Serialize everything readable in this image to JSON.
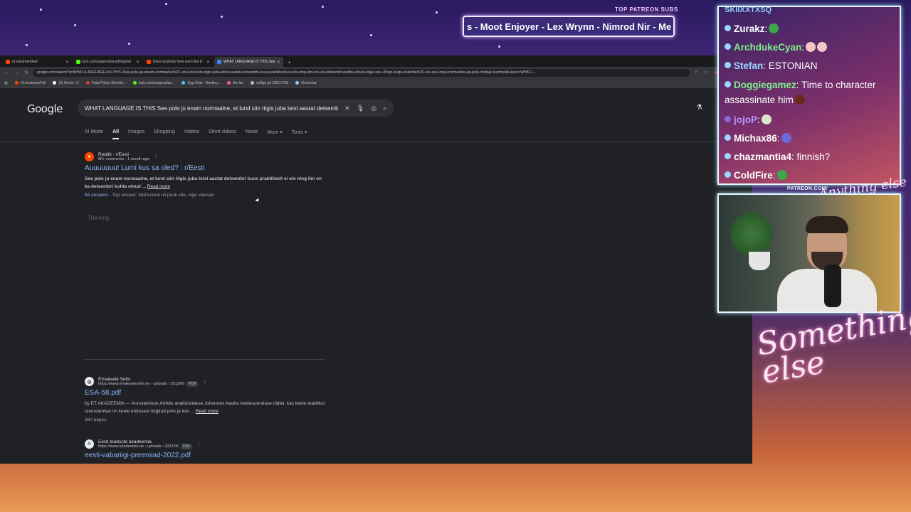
{
  "overlay": {
    "subs_heading": "TOP PATREON SUBS",
    "subs_ticker": "s - Moot Enjoyer - Lex Wrynn - Nimrod Nir - Me",
    "patreon_url": "PATREON.COM/",
    "brand_small": "Anything else",
    "brand_large": "Something else"
  },
  "browser": {
    "tabs": [
      {
        "label": "r/LivestreamFail",
        "color": "#ff4500",
        "active": false
      },
      {
        "label": "kick.com/popeout/anythingelse",
        "color": "#53fc18",
        "active": false
      },
      {
        "label": "Does anybody here even like D",
        "color": "#ff4500",
        "active": false
      },
      {
        "label": "WHAT LANGUAGE IS THIS See",
        "color": "#4285f4",
        "active": true
      }
    ],
    "url": "google.com/search?q=WHAT+LANGUAGE+IS+THIS+See+pole+ju+enam+normaalne%2C+et+lund+siin+riigis+juba+teist+aastat+detsembri+kuus+praktiliselt+ei+ole+ning+ilm+on+ka+detsembri+kohta+olnud+siiga+soe.+Änge+tulge+räakima%2C+et+see+ongi+normaalne+ja+pole+midagi+kummalist.&sca=WHAT+...",
    "bookmarks": [
      {
        "label": "r/LivestreamFail",
        "color": "#ff4500"
      },
      {
        "label": "(5) Home / X",
        "color": "#ffffff"
      },
      {
        "label": "Fatal Police Shootin...",
        "color": "#e53935"
      },
      {
        "label": "kick.com/popeout/an...",
        "color": "#53fc18"
      },
      {
        "label": "Dgg Chat - Destiny...",
        "color": "#4fc3f7"
      },
      {
        "label": "the list",
        "color": "#f06292"
      },
      {
        "label": "exflige.gif (299×278)",
        "color": "#bbbbbb"
      },
      {
        "label": "Omnichat",
        "color": "#90caf9"
      }
    ]
  },
  "google": {
    "logo": "Google",
    "query": "WHAT LANGUAGE IS THIS See pole ju enam normaalne, et lund siin riigis juba teist aastat detsembri",
    "tabs": [
      "AI Mode",
      "All",
      "Images",
      "Shopping",
      "Videos",
      "Short videos",
      "News",
      "More ▾",
      "Tools ▾"
    ],
    "active_tab": "All",
    "thinking": "Thinking",
    "results": [
      {
        "site": "Reddit · r/Eesti",
        "meta": "80+ comments · 1 month ago",
        "title": "Auuuuuuu! Lumi kus sa oled? : r/Eesti",
        "snippet": "See pole ju enam normaalne, et lund siin riigis juba teist aastat detsembri kuus praktiliselt ei ole ning ilm on ka detsembri kohta olnud ...",
        "read_more": "Read more",
        "answers": "84 answers",
        "top_answer": " · Top answer: Mul koeral oli puuk eile, olge valvsad"
      },
      {
        "site": "Emakeele Selts",
        "meta": "https://www.emakeeleselts.ee › uploads › 2013/06",
        "badge": "PDF",
        "title": "ESA-58.pdf",
        "snippet": "by ET AKADEEMIA — Annotatsioon.Artiklis analüüsitakse Johannes Aaviku keeleuuenduse näitel, kas keele teadlikul uuendamisel on keele ehitusest tingitud piire ja kas ...",
        "read_more": "Read more",
        "pages": "360 pages"
      },
      {
        "site": "Eesti teaduste akadeemia",
        "meta": "https://www.akadeemia.ee › uploads › 2022/06",
        "badge": "PDF",
        "title": "eesti-vabariigi-preemiad-2022.pdf"
      }
    ]
  },
  "chat": {
    "top_partial": "SKIIXXTXSQ",
    "messages": [
      {
        "user": "Zurakz",
        "text": ":",
        "user_color": "#ffffff",
        "emote_color": "#3aa84a"
      },
      {
        "user": "ArchdukeCyan",
        "text": ":",
        "user_color": "#7cf08a",
        "emote_color": "#f2c6c6"
      },
      {
        "user": "Stefan",
        "text": ": ESTONIAN",
        "user_color": "#9ad7ff"
      },
      {
        "user": "Doggiegamez",
        "text": ": Time to character assassinate him",
        "user_color": "#7cf08a",
        "emote_color": "#6a2a1a"
      },
      {
        "user": "jojoP",
        "text": ":",
        "user_color": "#b894ff",
        "emote_color": "#d8e8c8"
      },
      {
        "user": "Michax86",
        "text": ":",
        "user_color": "#ffffff",
        "emote_color": "#6a6ad8"
      },
      {
        "user": "chazmantia4",
        "text": ": finnish?",
        "user_color": "#ffffff"
      },
      {
        "user": "ColdFire",
        "text": ":",
        "user_color": "#ffffff",
        "emote_color": "#3aa84a"
      }
    ]
  }
}
